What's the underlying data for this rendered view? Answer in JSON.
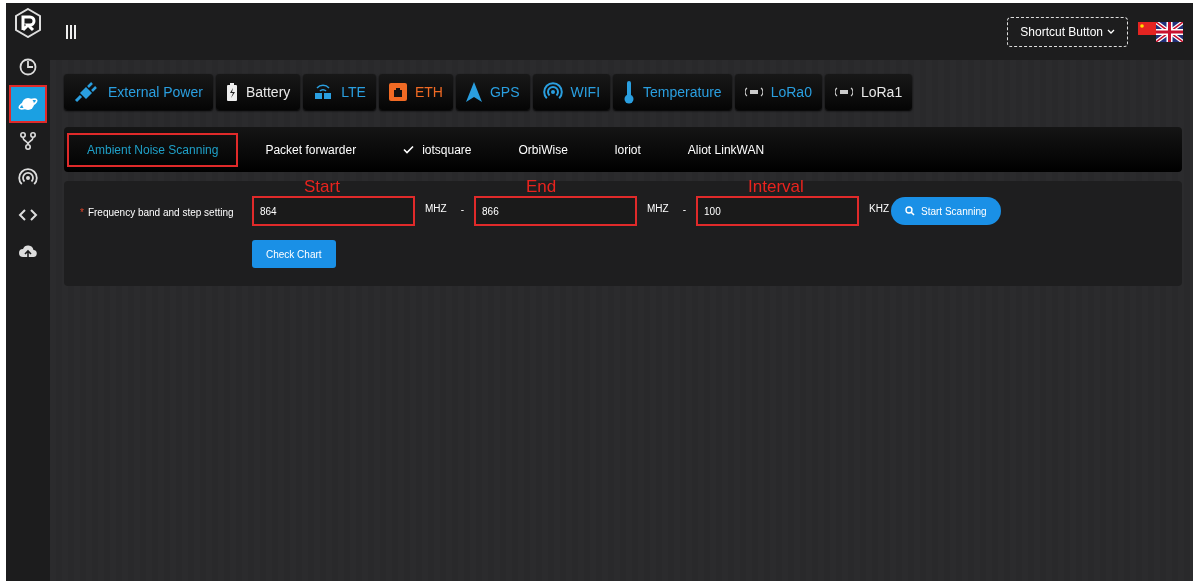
{
  "header": {
    "shortcut_button": "Shortcut Button"
  },
  "sidebar": {
    "items": [
      {
        "selected": false,
        "highlighted": false
      },
      {
        "selected": true,
        "highlighted": true
      },
      {
        "selected": false,
        "highlighted": false
      },
      {
        "selected": false,
        "highlighted": false
      },
      {
        "selected": false,
        "highlighted": false
      },
      {
        "selected": false,
        "highlighted": false
      }
    ]
  },
  "status_tiles": [
    {
      "label": "External Power",
      "color": "#2a9fe0"
    },
    {
      "label": "Battery",
      "color": "#e8e8e8"
    },
    {
      "label": "LTE",
      "color": "#2a9fe0"
    },
    {
      "label": "ETH",
      "color": "#f06a24"
    },
    {
      "label": "GPS",
      "color": "#2a9fe0"
    },
    {
      "label": "WIFI",
      "color": "#2a9fe0"
    },
    {
      "label": "Temperature",
      "color": "#2a9fe0"
    },
    {
      "label": "LoRa0",
      "color": "#2a9fe0"
    },
    {
      "label": "LoRa1",
      "color": "#e8e8e8"
    }
  ],
  "protocol_tabs": [
    {
      "label": "Ambient Noise Scanning",
      "selected": true,
      "checked": false,
      "highlighted": true
    },
    {
      "label": "Packet forwarder",
      "selected": false,
      "checked": false,
      "highlighted": false
    },
    {
      "label": "iotsquare",
      "selected": false,
      "checked": true,
      "highlighted": false
    },
    {
      "label": "OrbiWise",
      "selected": false,
      "checked": false,
      "highlighted": false
    },
    {
      "label": "loriot",
      "selected": false,
      "checked": false,
      "highlighted": false
    },
    {
      "label": "Aliot LinkWAN",
      "selected": false,
      "checked": false,
      "highlighted": false
    }
  ],
  "form": {
    "label": "Frequency band and step setting",
    "required_mark": "*",
    "fields": [
      {
        "annotation": "Start",
        "value": "864",
        "unit": "MHZ",
        "separator": "-",
        "highlighted": true
      },
      {
        "annotation": "End",
        "value": "866",
        "unit": "MHZ",
        "separator": "-",
        "highlighted": true
      },
      {
        "annotation": "Interval",
        "value": "100",
        "unit": "KHZ",
        "highlighted": true
      }
    ],
    "scan_button": "Start Scanning",
    "chart_button": "Check Chart"
  }
}
